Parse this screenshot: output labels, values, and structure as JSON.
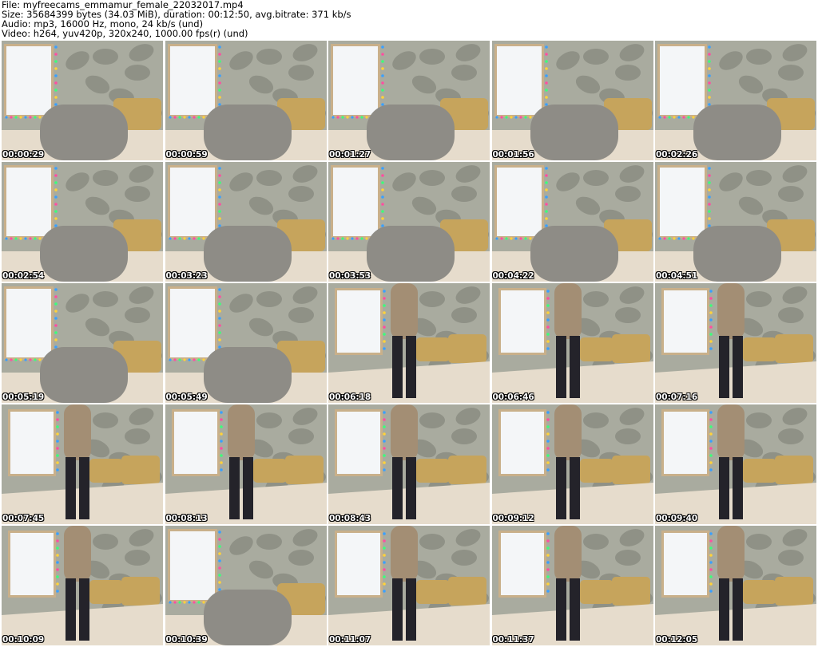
{
  "header": {
    "file": "File: myfreecams_emmamur_female_22032017.mp4",
    "size": "Size: 35684399 bytes (34.03 MiB), duration: 00:12:50, avg.bitrate: 371 kb/s",
    "audio": "Audio: mp3, 16000 Hz, mono, 24 kb/s (und)",
    "video": "Video: h264, yuv420p, 320x240, 1000.00 fps(r) (und)"
  },
  "thumbnails": [
    {
      "time": "00:00:29"
    },
    {
      "time": "00:00:59"
    },
    {
      "time": "00:01:27"
    },
    {
      "time": "00:01:56"
    },
    {
      "time": "00:02:26"
    },
    {
      "time": "00:02:54"
    },
    {
      "time": "00:03:23"
    },
    {
      "time": "00:03:53"
    },
    {
      "time": "00:04:22"
    },
    {
      "time": "00:04:51"
    },
    {
      "time": "00:05:19"
    },
    {
      "time": "00:05:49"
    },
    {
      "time": "00:06:18"
    },
    {
      "time": "00:06:46"
    },
    {
      "time": "00:07:16"
    },
    {
      "time": "00:07:45"
    },
    {
      "time": "00:08:13"
    },
    {
      "time": "00:08:43"
    },
    {
      "time": "00:09:12"
    },
    {
      "time": "00:09:40"
    },
    {
      "time": "00:10:09"
    },
    {
      "time": "00:10:39"
    },
    {
      "time": "00:11:07"
    },
    {
      "time": "00:11:37"
    },
    {
      "time": "00:12:05"
    }
  ],
  "colors": {
    "wall": "#a9ab9f",
    "wall_pattern": "#6f7269",
    "whiteboard": "#f4f6f8",
    "whiteboard_frame": "#c9b08a",
    "bed": "#e6dccc",
    "pillow": "#c6a45c",
    "timestamp": "#ffffff"
  }
}
